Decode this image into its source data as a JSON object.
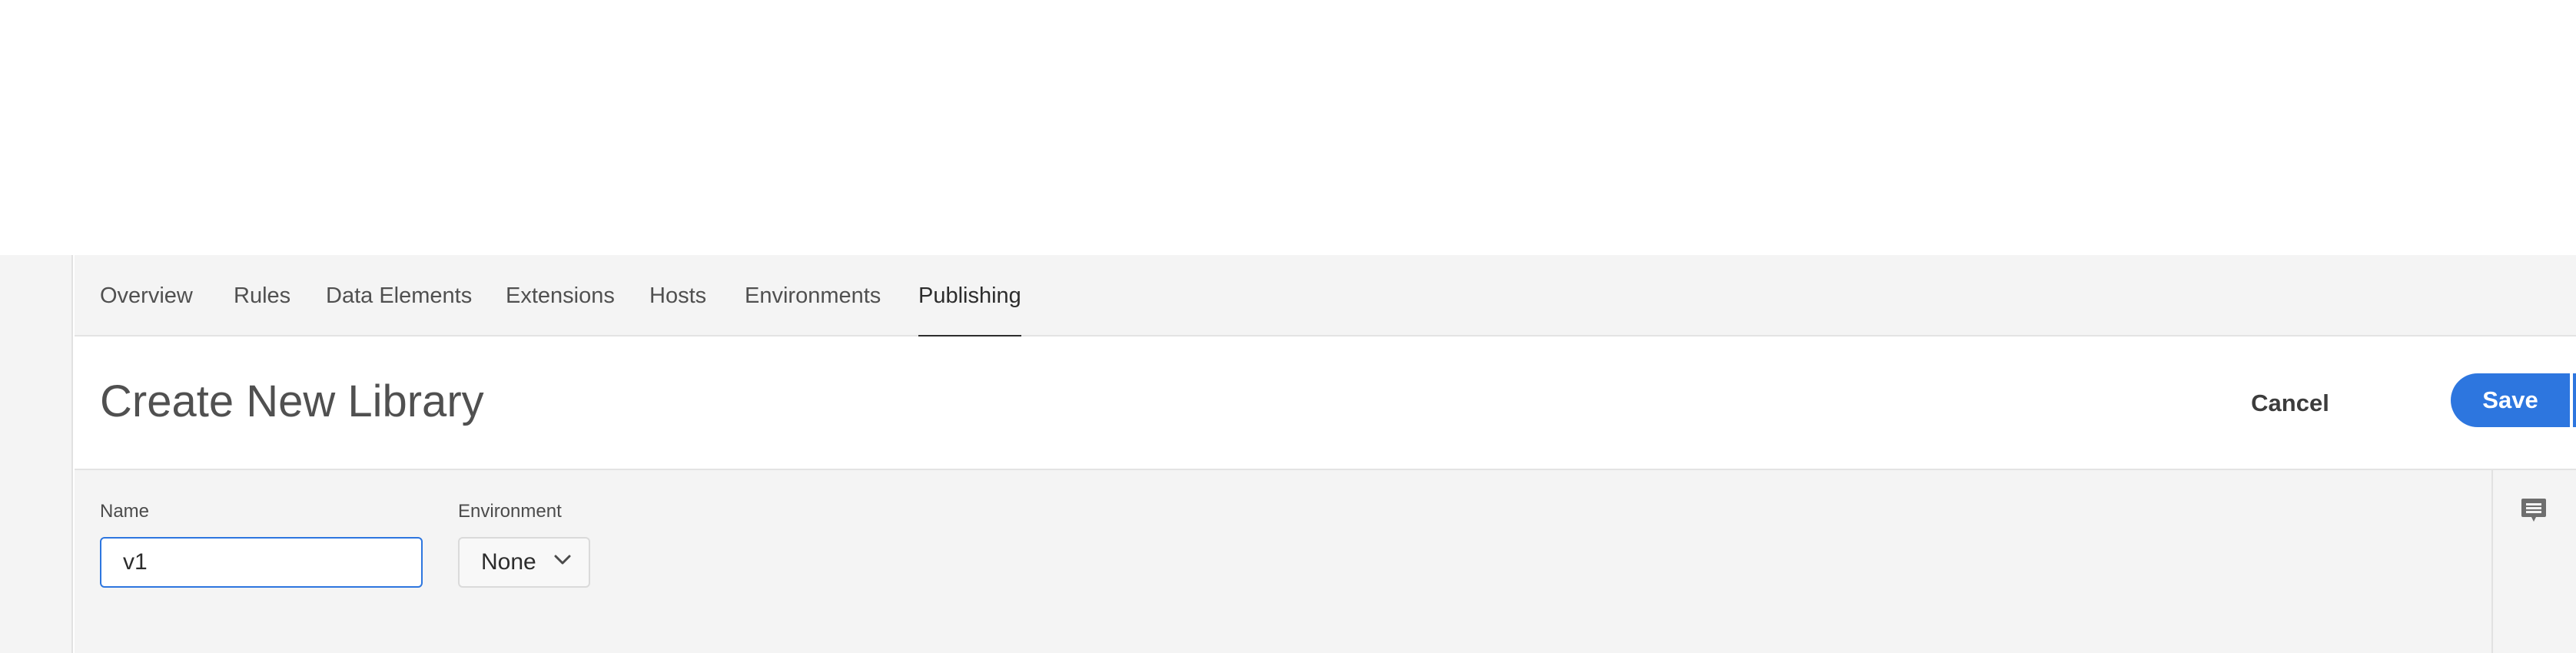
{
  "nav": {
    "tabs": [
      {
        "label": "Overview"
      },
      {
        "label": "Rules"
      },
      {
        "label": "Data Elements"
      },
      {
        "label": "Extensions"
      },
      {
        "label": "Hosts"
      },
      {
        "label": "Environments"
      },
      {
        "label": "Publishing",
        "active": true
      }
    ]
  },
  "header": {
    "title": "Create New Library",
    "cancel_label": "Cancel",
    "save_label": "Save",
    "save_menu_icon": "chevron-down-icon"
  },
  "form": {
    "name_label": "Name",
    "name_value": "v1",
    "environment_label": "Environment",
    "environment_value": "None",
    "environment_icon": "chevron-down-icon"
  },
  "right_rail": {
    "icon": "comment-icon"
  },
  "colors": {
    "accent": "#2d76df",
    "panel_bg": "#f4f4f4",
    "text_dark": "#2c2c2c"
  }
}
